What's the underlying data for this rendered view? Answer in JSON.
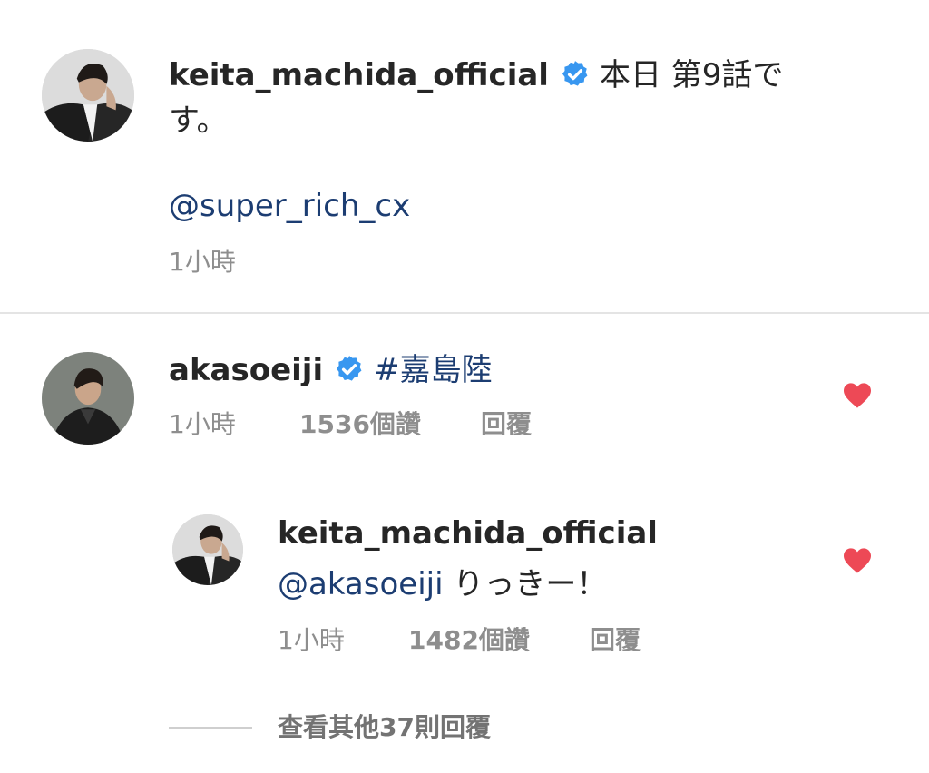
{
  "comments": [
    {
      "username": "keita_machida_official",
      "verified": true,
      "text_first": "本日 第9話で",
      "text_second": "す。",
      "mention": "@super_rich_cx",
      "time": "1小時",
      "avatar_icon": "avatar-keita-icon"
    },
    {
      "username": "akasoeiji",
      "verified": true,
      "hashtag": "#嘉島陸",
      "time": "1小時",
      "likes": "1536個讚",
      "reply_label": "回覆",
      "liked": true,
      "avatar_icon": "avatar-akaso-icon"
    }
  ],
  "reply": {
    "username": "keita_machida_official",
    "mention": "@akasoeiji",
    "text": " りっきー！",
    "time": "1小時",
    "likes": "1482個讚",
    "reply_label": "回覆",
    "liked": true,
    "avatar_icon": "avatar-keita-icon"
  },
  "view_more_replies": "查看其他37則回覆",
  "colors": {
    "heart": "#ed4956",
    "verified": "#3897f0",
    "mention": "#1c3d72"
  }
}
